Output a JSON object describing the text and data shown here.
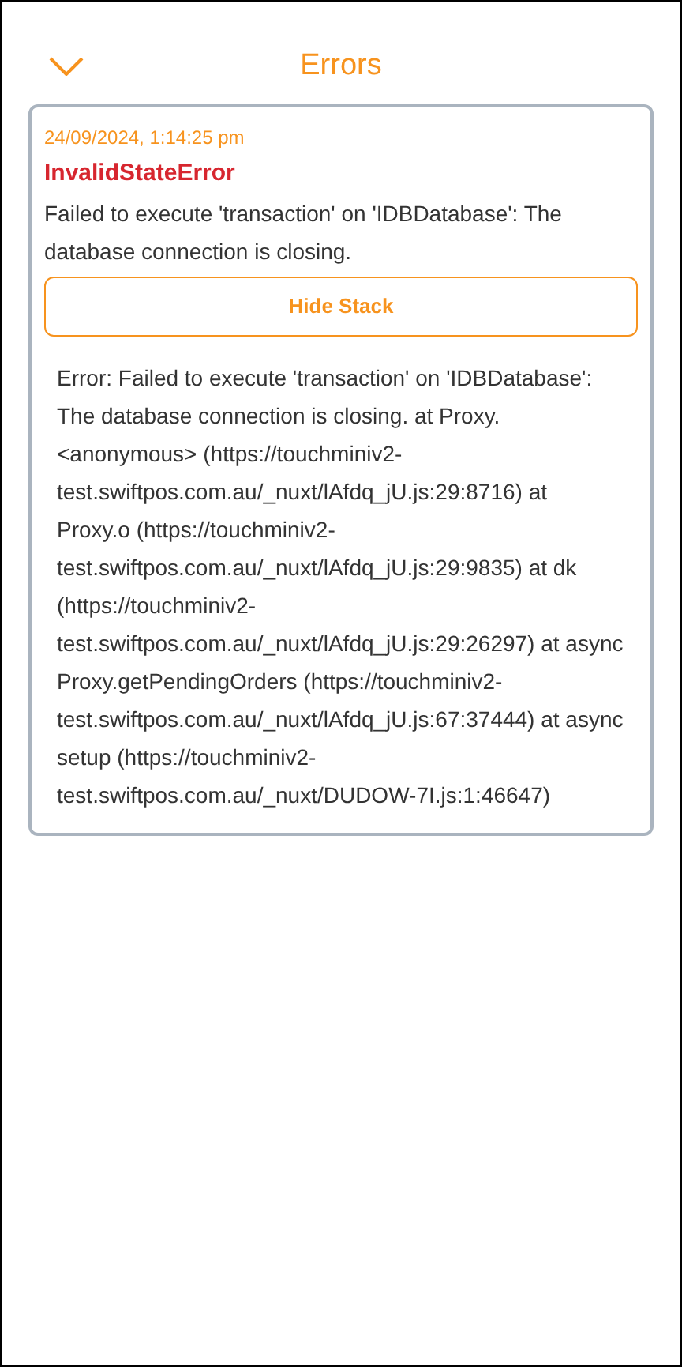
{
  "header": {
    "title": "Errors"
  },
  "errors": [
    {
      "timestamp": "24/09/2024, 1:14:25 pm",
      "name": "InvalidStateError",
      "message": "Failed to execute 'transaction' on 'IDBDatabase': The database connection is closing.",
      "stack_button": "Hide Stack",
      "stack": "Error: Failed to execute 'transaction' on 'IDBDatabase': The database connection is closing. at Proxy.<anonymous> (https://touchminiv2-test.swiftpos.com.au/_nuxt/lAfdq_jU.js:29:8716) at Proxy.o (https://touchminiv2-test.swiftpos.com.au/_nuxt/lAfdq_jU.js:29:9835) at dk (https://touchminiv2-test.swiftpos.com.au/_nuxt/lAfdq_jU.js:29:26297) at async Proxy.getPendingOrders (https://touchminiv2-test.swiftpos.com.au/_nuxt/lAfdq_jU.js:67:37444) at async setup (https://touchminiv2-test.swiftpos.com.au/_nuxt/DUDOW-7I.js:1:46647)"
    }
  ]
}
